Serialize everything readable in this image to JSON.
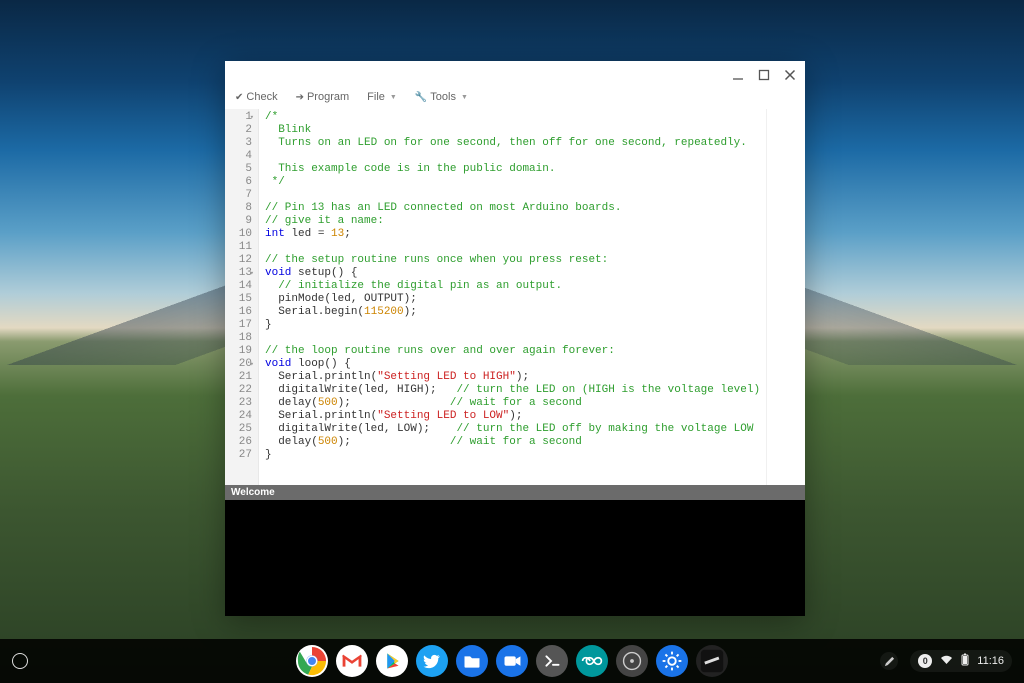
{
  "window_controls": {
    "min": "minimize",
    "max": "maximize",
    "close": "close"
  },
  "toolbar": {
    "check": "Check",
    "program": "Program",
    "file": "File",
    "tools": "Tools"
  },
  "code_lines": [
    {
      "n": 1,
      "fold": true,
      "segs": [
        {
          "t": "/*",
          "c": "c-comment"
        }
      ]
    },
    {
      "n": 2,
      "segs": [
        {
          "t": "  Blink",
          "c": "c-comment"
        }
      ]
    },
    {
      "n": 3,
      "segs": [
        {
          "t": "  Turns on an LED on for one second, then off for one second, repeatedly.",
          "c": "c-comment"
        }
      ]
    },
    {
      "n": 4,
      "segs": [
        {
          "t": " ",
          "c": ""
        }
      ]
    },
    {
      "n": 5,
      "segs": [
        {
          "t": "  This example code is in the public domain.",
          "c": "c-comment"
        }
      ]
    },
    {
      "n": 6,
      "segs": [
        {
          "t": " */",
          "c": "c-comment"
        }
      ]
    },
    {
      "n": 7,
      "segs": [
        {
          "t": " ",
          "c": ""
        }
      ]
    },
    {
      "n": 8,
      "segs": [
        {
          "t": "// Pin 13 has an LED connected on most Arduino boards.",
          "c": "c-comment"
        }
      ]
    },
    {
      "n": 9,
      "segs": [
        {
          "t": "// give it a name:",
          "c": "c-comment"
        }
      ]
    },
    {
      "n": 10,
      "segs": [
        {
          "t": "int",
          "c": "c-keyword"
        },
        {
          "t": " led = ",
          "c": ""
        },
        {
          "t": "13",
          "c": "c-number"
        },
        {
          "t": ";",
          "c": ""
        }
      ]
    },
    {
      "n": 11,
      "segs": [
        {
          "t": " ",
          "c": ""
        }
      ]
    },
    {
      "n": 12,
      "segs": [
        {
          "t": "// the setup routine runs once when you press reset:",
          "c": "c-comment"
        }
      ]
    },
    {
      "n": 13,
      "fold": true,
      "segs": [
        {
          "t": "void",
          "c": "c-keyword"
        },
        {
          "t": " setup() {",
          "c": ""
        }
      ]
    },
    {
      "n": 14,
      "segs": [
        {
          "t": "  // initialize the digital pin as an output.",
          "c": "c-comment"
        }
      ]
    },
    {
      "n": 15,
      "segs": [
        {
          "t": "  pinMode(led, OUTPUT);",
          "c": ""
        }
      ]
    },
    {
      "n": 16,
      "segs": [
        {
          "t": "  Serial.begin(",
          "c": ""
        },
        {
          "t": "115200",
          "c": "c-number"
        },
        {
          "t": ");",
          "c": ""
        }
      ]
    },
    {
      "n": 17,
      "segs": [
        {
          "t": "}",
          "c": ""
        }
      ]
    },
    {
      "n": 18,
      "segs": [
        {
          "t": " ",
          "c": ""
        }
      ]
    },
    {
      "n": 19,
      "segs": [
        {
          "t": "// the loop routine runs over and over again forever:",
          "c": "c-comment"
        }
      ]
    },
    {
      "n": 20,
      "fold": true,
      "segs": [
        {
          "t": "void",
          "c": "c-keyword"
        },
        {
          "t": " loop() {",
          "c": ""
        }
      ]
    },
    {
      "n": 21,
      "segs": [
        {
          "t": "  Serial.println(",
          "c": ""
        },
        {
          "t": "\"Setting LED to HIGH\"",
          "c": "c-string"
        },
        {
          "t": ");",
          "c": ""
        }
      ]
    },
    {
      "n": 22,
      "segs": [
        {
          "t": "  digitalWrite(led, HIGH);   ",
          "c": ""
        },
        {
          "t": "// turn the LED on (HIGH is the voltage level)",
          "c": "c-comment"
        }
      ]
    },
    {
      "n": 23,
      "segs": [
        {
          "t": "  delay(",
          "c": ""
        },
        {
          "t": "500",
          "c": "c-number"
        },
        {
          "t": ");               ",
          "c": ""
        },
        {
          "t": "// wait for a second",
          "c": "c-comment"
        }
      ]
    },
    {
      "n": 24,
      "segs": [
        {
          "t": "  Serial.println(",
          "c": ""
        },
        {
          "t": "\"Setting LED to LOW\"",
          "c": "c-string"
        },
        {
          "t": ");",
          "c": ""
        }
      ]
    },
    {
      "n": 25,
      "segs": [
        {
          "t": "  digitalWrite(led, LOW);    ",
          "c": ""
        },
        {
          "t": "// turn the LED off by making the voltage LOW",
          "c": "c-comment"
        }
      ]
    },
    {
      "n": 26,
      "segs": [
        {
          "t": "  delay(",
          "c": ""
        },
        {
          "t": "500",
          "c": "c-number"
        },
        {
          "t": ");               ",
          "c": ""
        },
        {
          "t": "// wait for a second",
          "c": "c-comment"
        }
      ]
    },
    {
      "n": 27,
      "segs": [
        {
          "t": "}",
          "c": ""
        }
      ]
    }
  ],
  "status": {
    "welcome": "Welcome"
  },
  "tray": {
    "notifications": "0",
    "time": "11:16"
  },
  "shelf_icons": [
    {
      "name": "chrome-icon",
      "bg": "#fff"
    },
    {
      "name": "gmail-icon",
      "bg": "#fff"
    },
    {
      "name": "play-store-icon",
      "bg": "#fff"
    },
    {
      "name": "twitter-icon",
      "bg": "#1da1f2"
    },
    {
      "name": "files-icon",
      "bg": "#1a73e8"
    },
    {
      "name": "video-icon",
      "bg": "#1a73e8"
    },
    {
      "name": "terminal-icon",
      "bg": "#555"
    },
    {
      "name": "arduino-icon",
      "bg": "#00979c"
    },
    {
      "name": "music-icon",
      "bg": "#444"
    },
    {
      "name": "settings-icon",
      "bg": "#1a73e8"
    },
    {
      "name": "app-icon",
      "bg": "#222"
    }
  ]
}
